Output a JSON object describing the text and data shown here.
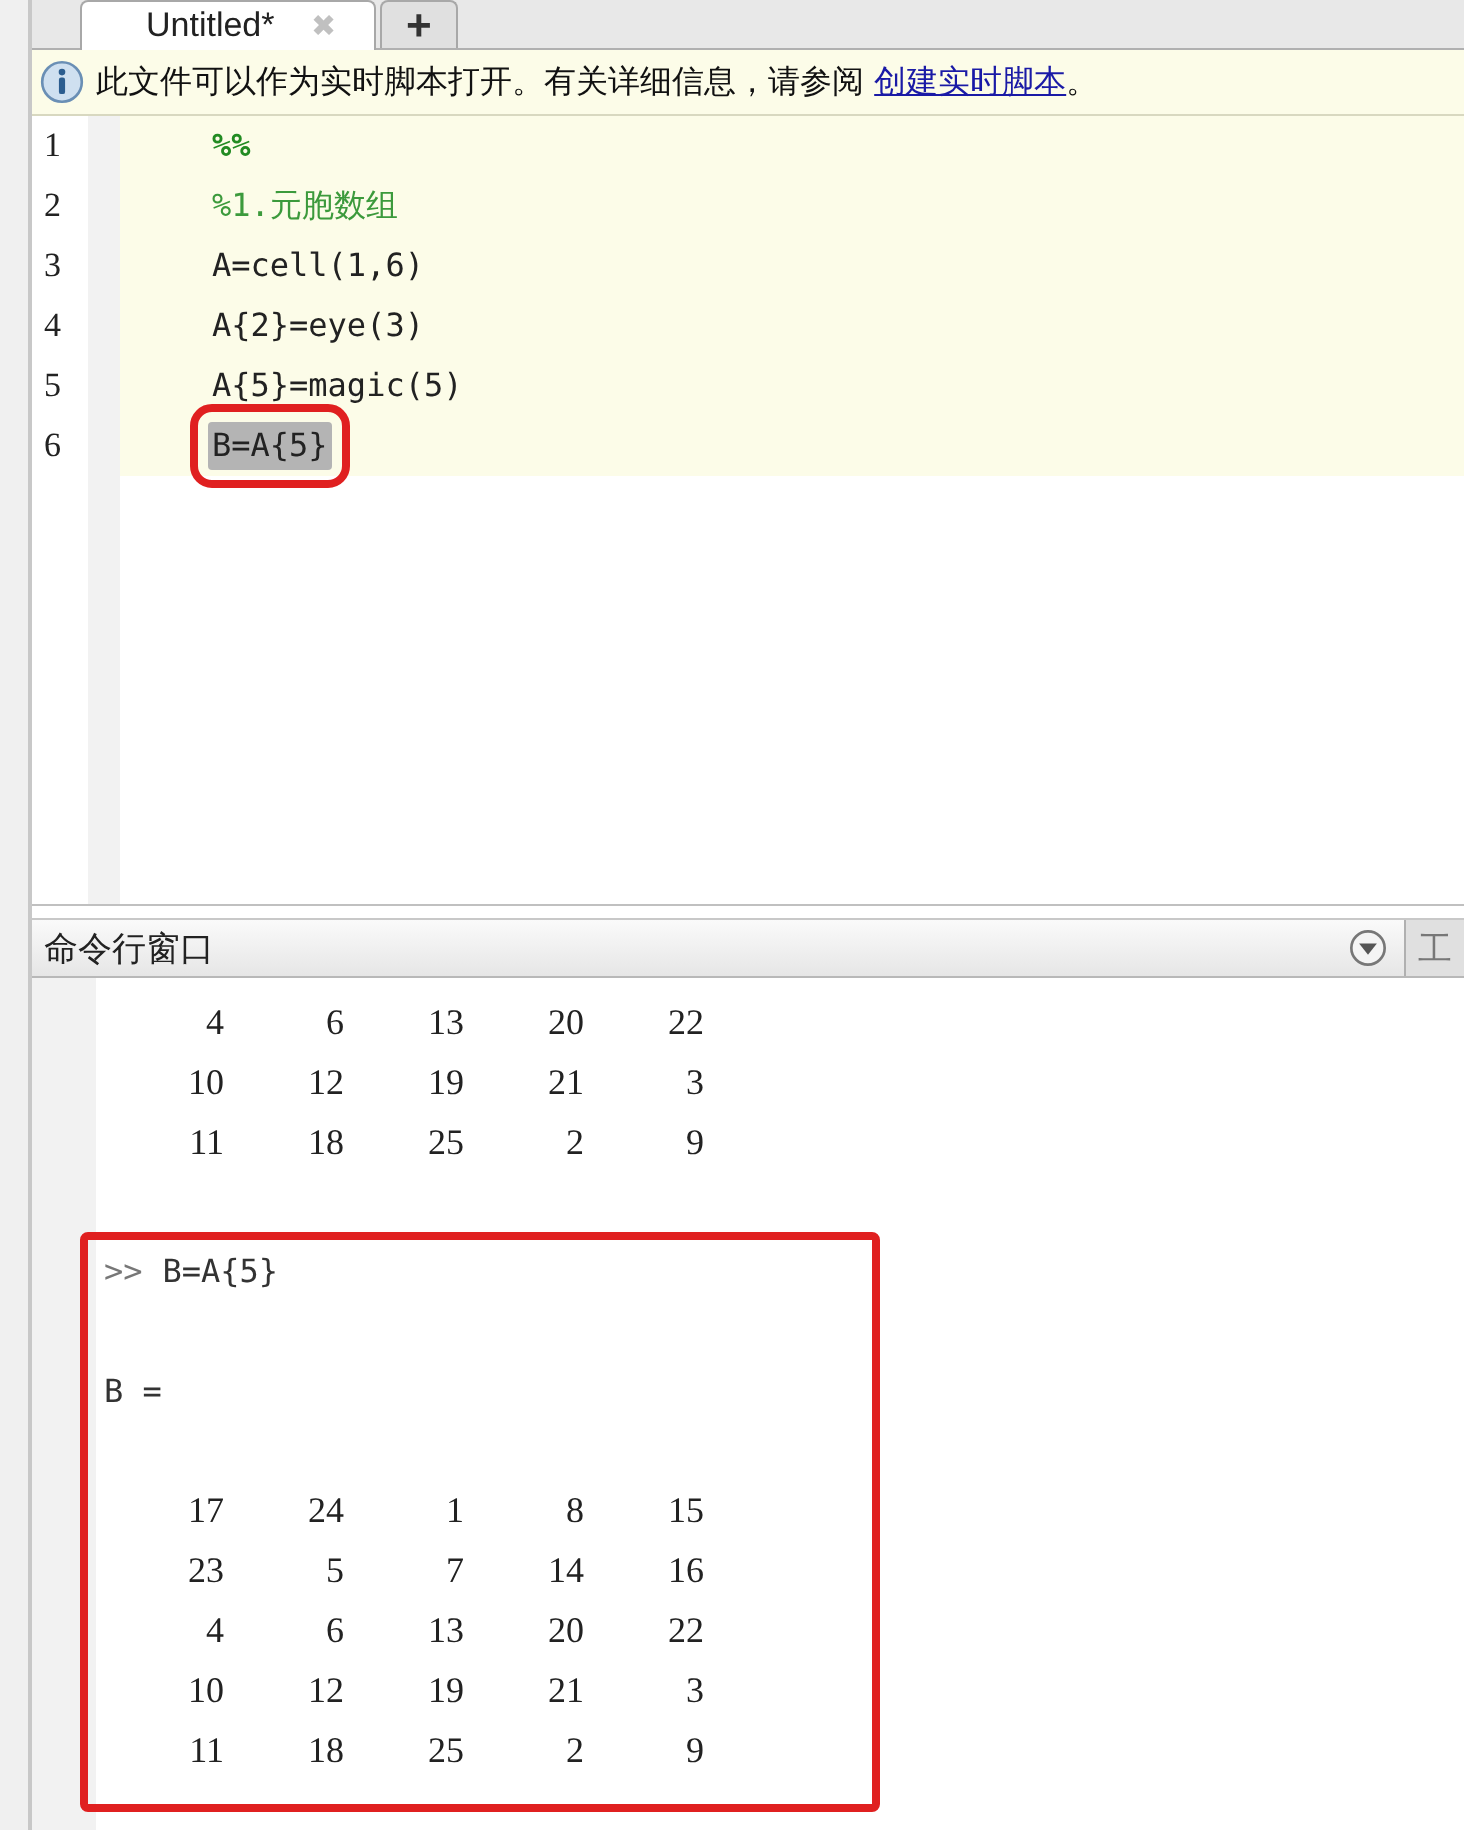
{
  "tabs": [
    {
      "label": "Untitled*",
      "selected": true,
      "kind": "file",
      "close": "✖"
    },
    {
      "label": "+",
      "selected": false,
      "kind": "add"
    }
  ],
  "info_bar": {
    "text": "此文件可以作为实时脚本打开。有关详细信息，请参阅",
    "link": "创建实时脚本",
    "tail": "。"
  },
  "editor": {
    "lines": [
      {
        "number": "1",
        "code": "%%",
        "kind": "section",
        "selected": false,
        "annotated": false
      },
      {
        "number": "2",
        "code": "%1.元胞数组",
        "kind": "comment",
        "selected": false,
        "annotated": false
      },
      {
        "number": "3",
        "code": "A=cell(1,6)",
        "kind": "code",
        "selected": false,
        "annotated": false
      },
      {
        "number": "4",
        "code": "A{2}=eye(3)",
        "kind": "code",
        "selected": false,
        "annotated": false
      },
      {
        "number": "5",
        "code": "A{5}=magic(5)",
        "kind": "code",
        "selected": false,
        "annotated": false
      },
      {
        "number": "6",
        "code": "B=A{5}",
        "kind": "code",
        "selected": true,
        "annotated": true
      }
    ]
  },
  "command_window": {
    "title": "命令行窗口",
    "side_tab": "工",
    "previous_rows": [
      [
        "4",
        "6",
        "13",
        "20",
        "22"
      ],
      [
        "10",
        "12",
        "19",
        "21",
        "3"
      ],
      [
        "11",
        "18",
        "25",
        "2",
        "9"
      ]
    ],
    "annotated": true,
    "prompt": ">>",
    "command": "B=A{5}",
    "result_label": "B =",
    "rows": [
      [
        "17",
        "24",
        "1",
        "8",
        "15"
      ],
      [
        "23",
        "5",
        "7",
        "14",
        "16"
      ],
      [
        "4",
        "6",
        "13",
        "20",
        "22"
      ],
      [
        "10",
        "12",
        "19",
        "21",
        "3"
      ],
      [
        "11",
        "18",
        "25",
        "2",
        "9"
      ]
    ]
  }
}
